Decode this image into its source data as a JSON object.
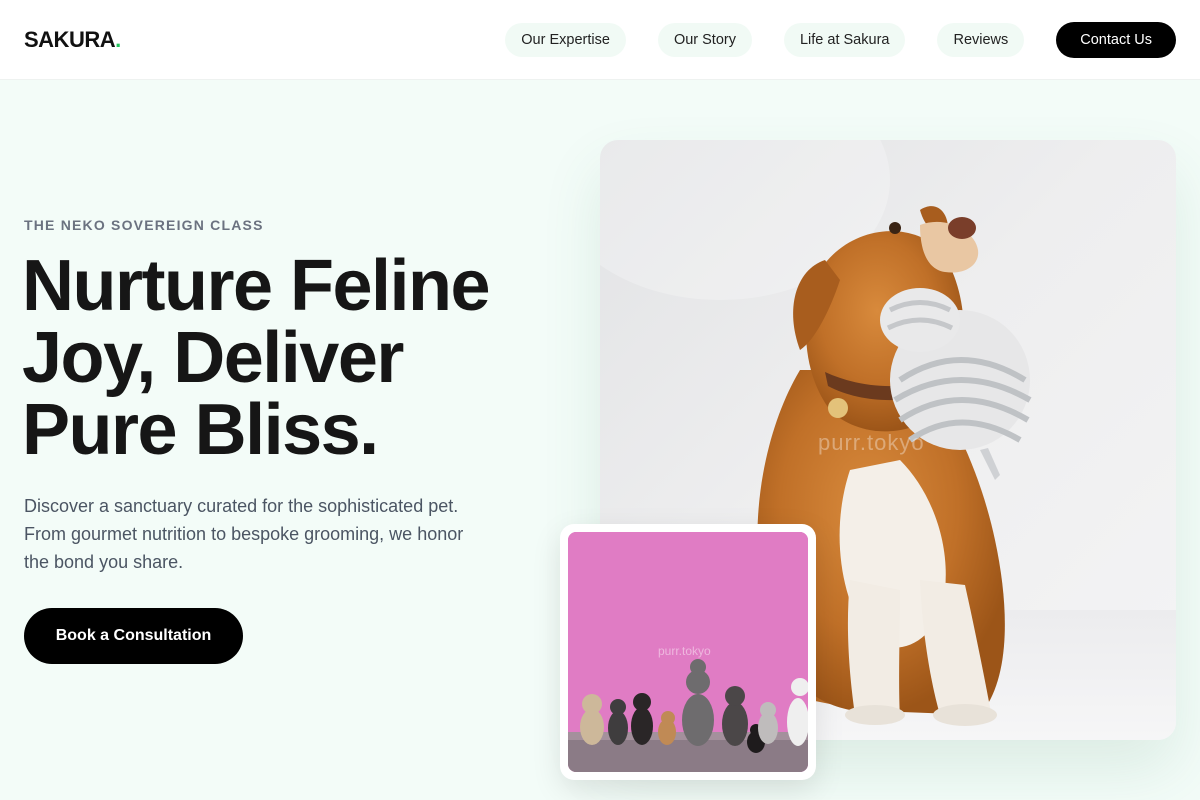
{
  "brand": {
    "name": "SAKURA",
    "dot": ".",
    "accent": "#22c55e"
  },
  "nav": {
    "items": [
      "Our Expertise",
      "Our Story",
      "Life at Sakura",
      "Reviews"
    ],
    "contact_label": "Contact Us"
  },
  "hero": {
    "eyebrow": "THE NEKO SOVEREIGN CLASS",
    "headline_lines": [
      "Nurture Feline",
      "Joy, Deliver",
      "Pure Bliss."
    ],
    "subtext": "Discover a sanctuary curated for the sophisticated pet. From gourmet nutrition to bespoke grooming, we honor the bond you share.",
    "cta_label": "Book a Consultation"
  },
  "images": {
    "main_watermark": "purr.tokyo",
    "small_watermark": "purr.tokyo"
  },
  "colors": {
    "background": "#f3fcf8",
    "primary_button": "#000000",
    "small_photo_bg": "#e07cc4"
  }
}
